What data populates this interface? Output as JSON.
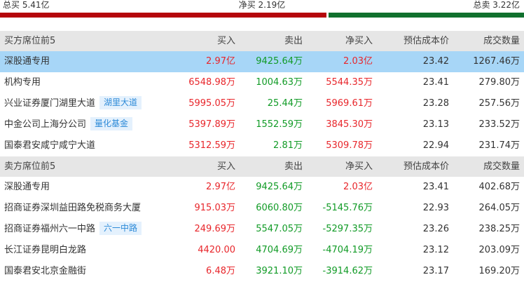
{
  "summary": {
    "buy_total": "总买 5.41亿",
    "net_total": "净买 2.19亿",
    "sell_total": "总卖 3.22亿",
    "bar_buy_fraction": 0.627,
    "colors": {
      "buy": "#b5060c",
      "sell": "#10702d"
    }
  },
  "columns": {
    "buy_section_title": "买方席位前5",
    "sell_section_title": "卖方席位前5",
    "buy": "买入",
    "sell": "卖出",
    "net": "净买入",
    "cost": "预估成本价",
    "volume": "成交数量"
  },
  "buy_rows": [
    {
      "name": "深股通专用",
      "tag": "",
      "buy": "2.97亿",
      "sell": "9425.64万",
      "net": "2.03亿",
      "net_sign": "pos",
      "cost": "23.42",
      "volume": "1267.46万"
    },
    {
      "name": "机构专用",
      "tag": "",
      "buy": "6548.98万",
      "sell": "1004.63万",
      "net": "5544.35万",
      "net_sign": "pos",
      "cost": "23.41",
      "volume": "279.80万"
    },
    {
      "name": "兴业证券厦门湖里大道",
      "tag": "湖里大道",
      "buy": "5995.05万",
      "sell": "25.44万",
      "net": "5969.61万",
      "net_sign": "pos",
      "cost": "23.28",
      "volume": "257.56万"
    },
    {
      "name": "中金公司上海分公司",
      "tag": "量化基金",
      "buy": "5397.89万",
      "sell": "1552.59万",
      "net": "3845.30万",
      "net_sign": "pos",
      "cost": "23.13",
      "volume": "233.52万"
    },
    {
      "name": "国泰君安咸宁咸宁大道",
      "tag": "",
      "buy": "5312.59万",
      "sell": "2.81万",
      "net": "5309.78万",
      "net_sign": "pos",
      "cost": "22.94",
      "volume": "231.74万"
    }
  ],
  "sell_rows": [
    {
      "name": "深股通专用",
      "tag": "",
      "buy": "2.97亿",
      "sell": "9425.64万",
      "net": "2.03亿",
      "net_sign": "pos",
      "cost": "23.41",
      "volume": "402.68万"
    },
    {
      "name": "招商证券深圳益田路免税商务大厦",
      "tag": "",
      "buy": "915.03万",
      "sell": "6060.80万",
      "net": "-5145.76万",
      "net_sign": "neg",
      "cost": "22.93",
      "volume": "264.05万"
    },
    {
      "name": "招商证券福州六一中路",
      "tag": "六一中路",
      "buy": "249.69万",
      "sell": "5547.05万",
      "net": "-5297.35万",
      "net_sign": "neg",
      "cost": "23.26",
      "volume": "238.25万"
    },
    {
      "name": "长江证券昆明白龙路",
      "tag": "",
      "buy": "4420.00",
      "sell": "4704.69万",
      "net": "-4704.19万",
      "net_sign": "neg",
      "cost": "23.12",
      "volume": "203.09万"
    },
    {
      "name": "国泰君安北京金融街",
      "tag": "",
      "buy": "6.48万",
      "sell": "3921.10万",
      "net": "-3914.62万",
      "net_sign": "neg",
      "cost": "23.17",
      "volume": "169.20万"
    }
  ]
}
